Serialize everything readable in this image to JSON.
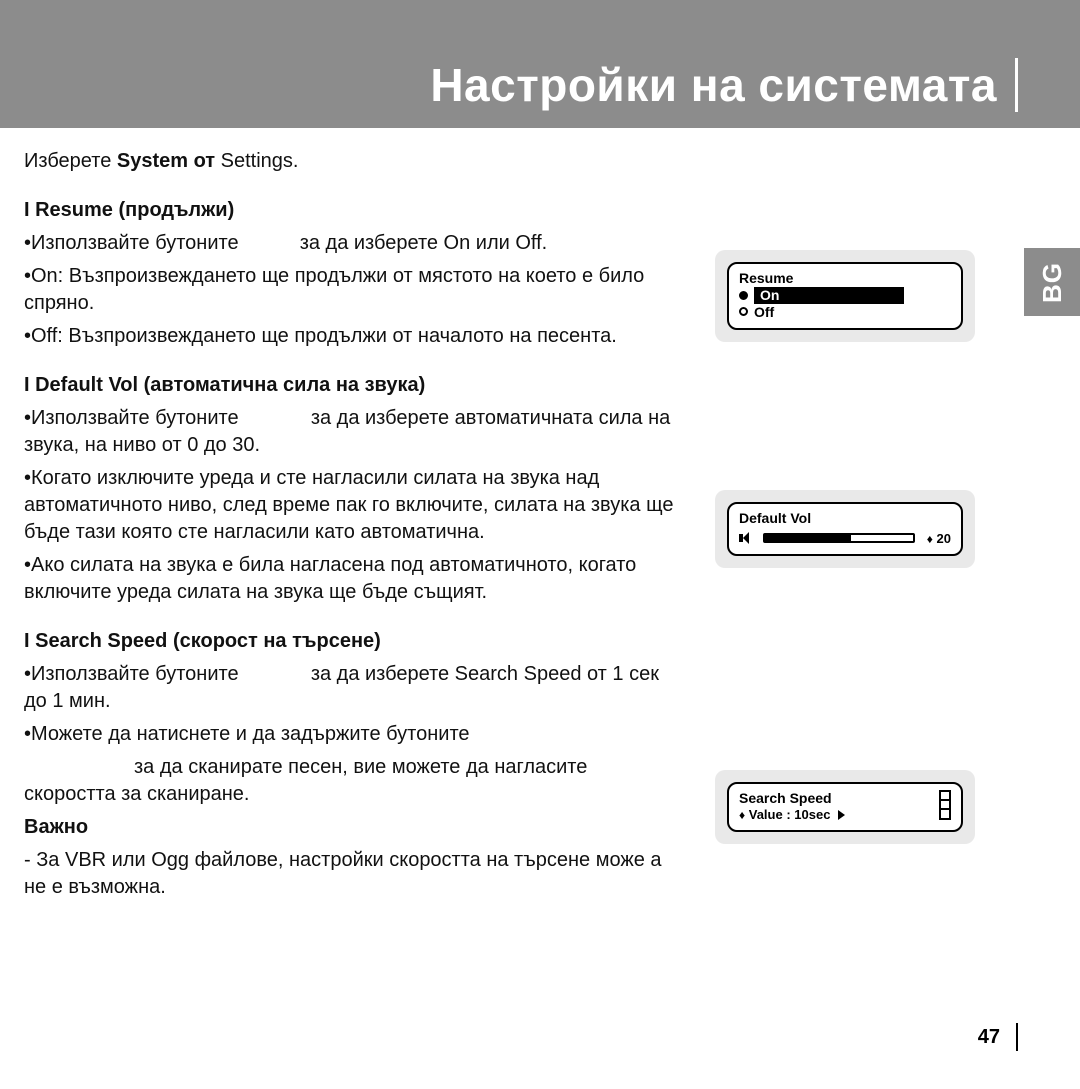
{
  "title": "Настройки на системата",
  "side_tab": "BG",
  "page_number": "47",
  "intro": {
    "prefix": "Изберете ",
    "strong": "System от",
    "suffix": " Settings."
  },
  "sections": {
    "resume": {
      "heading": "I Resume (продължи)",
      "p1a": "•Използвайте бутоните",
      "p1b": "за да изберете On или Off.",
      "p2": "•On: Възпроизвеждането ще продължи от мястото на което е било спряно.",
      "p3": "•Off: Възпроизвеждането ще продължи от началото на песента."
    },
    "default_vol": {
      "heading": "I Default Vol (автоматична сила на звука)",
      "p1a": "•Използвайте бутоните",
      "p1b": "за да изберете автоматичната сила на звука, на ниво от 0 до 30.",
      "p2": "•Когато изключите уреда и сте нагласили силата на звука над автоматичното ниво, след време пак го включите, силата на звука ще бъде тази която сте нагласили като автоматична.",
      "p3": "•Ако силата на звука е била нагласена под автоматичното, когато включите уреда силата на  звука ще бъде същият."
    },
    "search_speed": {
      "heading": "I Search Speed (скорост на търсене)",
      "p1a": "•Използвайте бутоните",
      "p1b": "за да изберете Search Speed от 1 сек до 1 мин.",
      "p2a": "•Можете да натиснете и да задържите бутоните",
      "p2b": "за да сканирате песен, вие можете да нагласите скоростта за сканиране.",
      "note_head": "Важно",
      "note": "- За VBR или Ogg файлове, настройки скоростта на търсене може а не е възможна."
    }
  },
  "lcd": {
    "resume": {
      "title": "Resume",
      "on": "On",
      "off": "Off"
    },
    "default_vol": {
      "title": "Default Vol",
      "value": "20"
    },
    "search_speed": {
      "title": "Search Speed",
      "value": "Value : 10sec"
    }
  }
}
